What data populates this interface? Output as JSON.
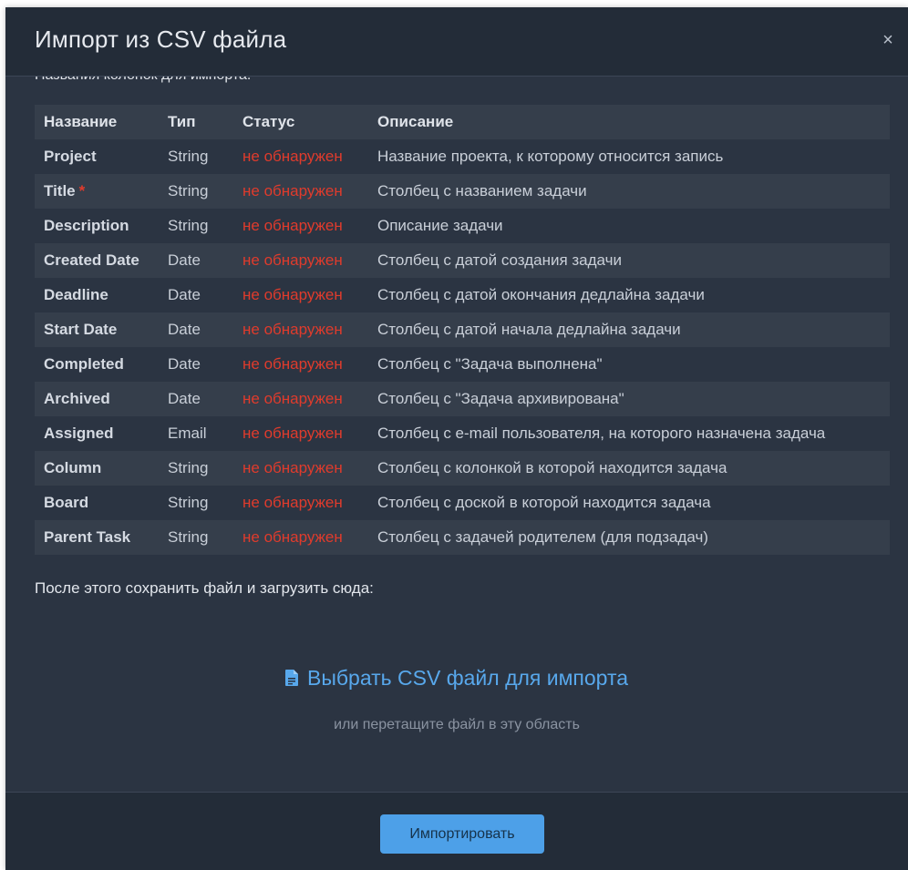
{
  "dialog": {
    "title": "Импорт из CSV файла",
    "close_label": "×"
  },
  "body": {
    "cut_heading": "Названия колонок для импорта:",
    "table": {
      "headers": {
        "name": "Название",
        "type": "Тип",
        "status": "Статус",
        "description": "Описание"
      },
      "rows": [
        {
          "name": "Project",
          "required": false,
          "type": "String",
          "status": "не обнаружен",
          "description": "Название проекта, к которому относится запись"
        },
        {
          "name": "Title",
          "required": true,
          "type": "String",
          "status": "не обнаружен",
          "description": "Столбец с названием задачи"
        },
        {
          "name": "Description",
          "required": false,
          "type": "String",
          "status": "не обнаружен",
          "description": "Описание задачи"
        },
        {
          "name": "Created Date",
          "required": false,
          "type": "Date",
          "status": "не обнаружен",
          "description": "Столбец с датой создания задачи"
        },
        {
          "name": "Deadline",
          "required": false,
          "type": "Date",
          "status": "не обнаружен",
          "description": "Столбец с датой окончания дедлайна задачи"
        },
        {
          "name": "Start Date",
          "required": false,
          "type": "Date",
          "status": "не обнаружен",
          "description": "Столбец с датой начала дедлайна задачи"
        },
        {
          "name": "Completed",
          "required": false,
          "type": "Date",
          "status": "не обнаружен",
          "description": "Столбец с \"Задача выполнена\""
        },
        {
          "name": "Archived",
          "required": false,
          "type": "Date",
          "status": "не обнаружен",
          "description": "Столбец с \"Задача архивирована\""
        },
        {
          "name": "Assigned",
          "required": false,
          "type": "Email",
          "status": "не обнаружен",
          "description": "Столбец с e-mail пользователя, на которого назначена задача"
        },
        {
          "name": "Column",
          "required": false,
          "type": "String",
          "status": "не обнаружен",
          "description": "Столбец с колонкой в которой находится задача"
        },
        {
          "name": "Board",
          "required": false,
          "type": "String",
          "status": "не обнаружен",
          "description": "Столбец с доской в которой находится задача"
        },
        {
          "name": "Parent Task",
          "required": false,
          "type": "String",
          "status": "не обнаружен",
          "description": "Столбец с задачей родителем (для подзадач)"
        }
      ],
      "required_marker": "*"
    },
    "after_text": "После этого сохранить файл и загрузить сюда:",
    "upload": {
      "icon": "file-text-icon",
      "link_text": "Выбрать CSV файл для импорта",
      "hint": "или перетащите файл в эту область"
    }
  },
  "footer": {
    "import_button": "Импортировать"
  },
  "colors": {
    "modal_bg": "#2b3442",
    "header_bg": "#232c38",
    "row_alt_bg": "#353e4b",
    "status_red": "#e03b2c",
    "link_blue": "#58a8ec",
    "button_bg": "#4da0e8"
  }
}
